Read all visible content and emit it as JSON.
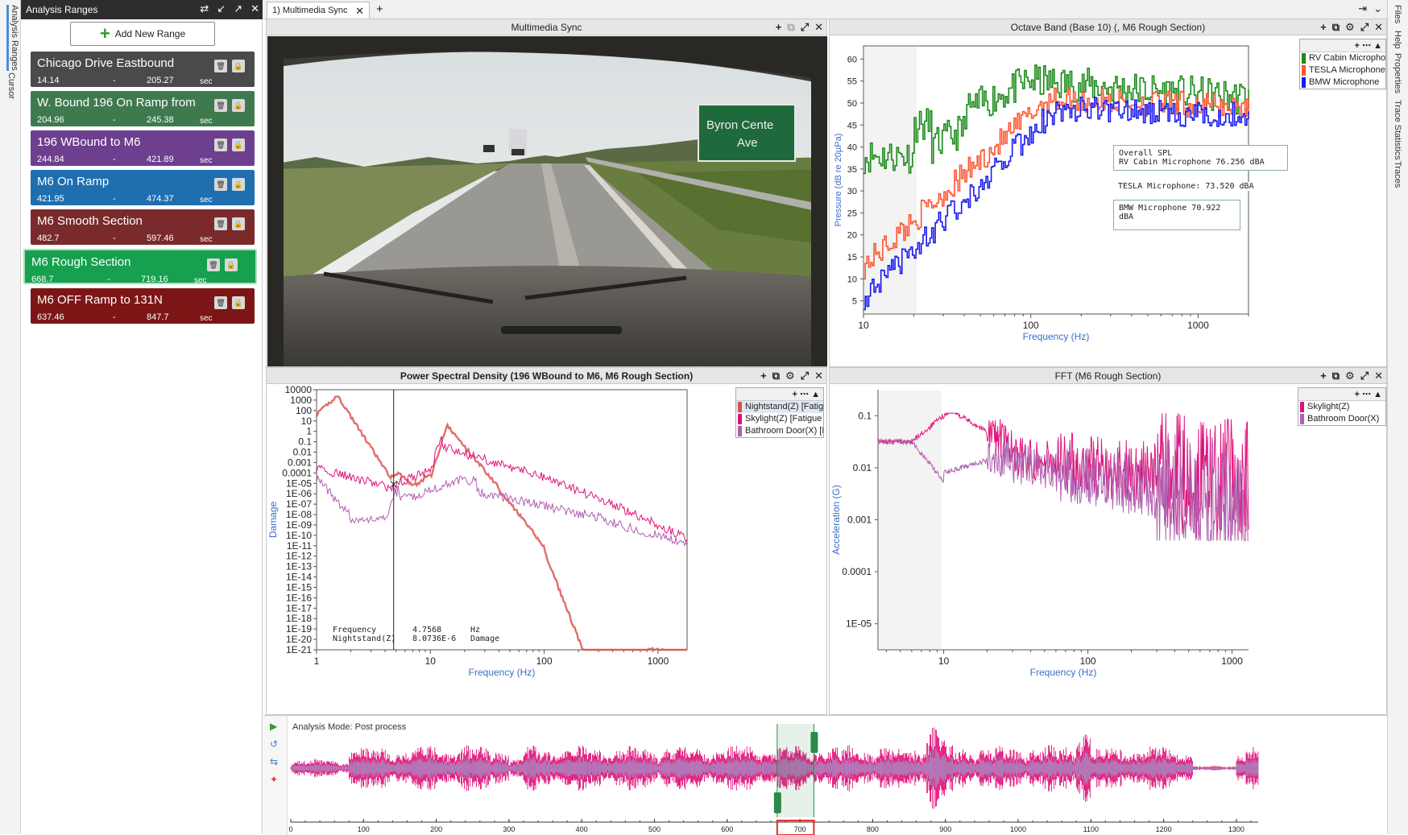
{
  "left_tabs": [
    "Analysis Ranges",
    "Cursor"
  ],
  "right_tabs": [
    "Files",
    "Help",
    "Properties",
    "Trace Statistics",
    "Traces"
  ],
  "ranges_panel": {
    "title": "Analysis Ranges",
    "add_button_label": "Add New Range",
    "unit": "sec",
    "dash": "-",
    "items": [
      {
        "name": "Chicago Drive Eastbound",
        "start": "14.14",
        "end": "205.27",
        "color": "#4a4a4a"
      },
      {
        "name": "W. Bound 196 On Ramp from",
        "start": "204.96",
        "end": "245.38",
        "color": "#3f7a4f"
      },
      {
        "name": "196 WBound to M6",
        "start": "244.84",
        "end": "421.89",
        "color": "#6e3f8e"
      },
      {
        "name": "M6 On Ramp",
        "start": "421.95",
        "end": "474.37",
        "color": "#1f6fb0"
      },
      {
        "name": "M6 Smooth Section",
        "start": "482.7",
        "end": "597.46",
        "color": "#7a2a2a"
      },
      {
        "name": "M6 Rough Section",
        "start": "668.7",
        "end": "719.16",
        "color": "#16a050"
      },
      {
        "name": "M6 OFF Ramp to 131N",
        "start": "637.46",
        "end": "847.7",
        "color": "#7c1515"
      }
    ]
  },
  "doc_tab": {
    "label": "1) Multimedia Sync"
  },
  "video_pane": {
    "title": "Multimedia Sync",
    "sign_line1": "Byron Cente",
    "sign_line2": "Ave"
  },
  "octave_pane": {
    "title": "Octave Band (Base 10) (, M6 Rough Section)",
    "ylabel": "Pressure (dB re 20µPa)",
    "xlabel": "Frequency (Hz)",
    "yticks": [
      "60",
      "55",
      "50",
      "45",
      "40",
      "35",
      "30",
      "25",
      "20",
      "15",
      "10",
      "5"
    ],
    "xticks": [
      "10",
      "100",
      "1000"
    ],
    "legend": [
      {
        "name": "RV Cabin Microphone",
        "color": "#1a8a1a"
      },
      {
        "name": "TESLA Microphone",
        "color": "#ff5533"
      },
      {
        "name": "BMW Microphone",
        "color": "#1a1aee"
      }
    ],
    "annot1_line1": "Overall SPL",
    "annot1_line2": "RV Cabin Microphone   76.256  dBA",
    "annot2": "TESLA Microphone: 73.520 dBA",
    "annot3": "BMW Microphone 70.922 dBA"
  },
  "psd_pane": {
    "title": "Power Spectral Density (196 WBound to M6, M6 Rough Section)",
    "ylabel": "Damage",
    "xlabel": "Frequency (Hz)",
    "yticks": [
      "10000",
      "1000",
      "100",
      "10",
      "1",
      "0.1",
      "0.01",
      "0.001",
      "0.0001",
      "1E-05",
      "1E-06",
      "1E-07",
      "1E-08",
      "1E-09",
      "1E-10",
      "1E-11",
      "1E-12",
      "1E-13",
      "1E-14",
      "1E-15",
      "1E-16",
      "1E-17",
      "1E-18",
      "1E-19",
      "1E-20",
      "1E-21"
    ],
    "xticks": [
      "1",
      "10",
      "100",
      "1000"
    ],
    "legend": [
      {
        "name": "Nightstand(Z) [Fatigu",
        "color": "#d9534f"
      },
      {
        "name": "Skylight(Z) [Fatigue D",
        "color": "#e0127a"
      },
      {
        "name": "Bathroom Door(X) [F",
        "color": "#b05fb0"
      }
    ],
    "cursor_freq_label": "Frequency",
    "cursor_freq_value": "4.7568",
    "cursor_freq_unit": "Hz",
    "cursor_series_label": "Nightstand(Z)",
    "cursor_series_value": "8.0736E-6",
    "cursor_series_unit": "Damage"
  },
  "fft_pane": {
    "title": "FFT (M6 Rough Section)",
    "ylabel": "Acceleration (G)",
    "xlabel": "Frequency (Hz)",
    "yticks": [
      "0.1",
      "0.01",
      "0.001",
      "0.0001",
      "1E-05"
    ],
    "xticks": [
      "10",
      "100",
      "1000"
    ],
    "legend": [
      {
        "name": "Skylight(Z)",
        "color": "#e0127a"
      },
      {
        "name": "Bathroom Door(X)",
        "color": "#b05fb0"
      }
    ]
  },
  "timeline": {
    "mode_label": "Analysis Mode: Post process",
    "xticks": [
      "0",
      "100",
      "200",
      "300",
      "400",
      "500",
      "600",
      "700",
      "800",
      "900",
      "1000",
      "1100",
      "1200",
      "1300"
    ],
    "range_start": 668.7,
    "range_end": 719.16,
    "cursor_value": 720
  }
}
